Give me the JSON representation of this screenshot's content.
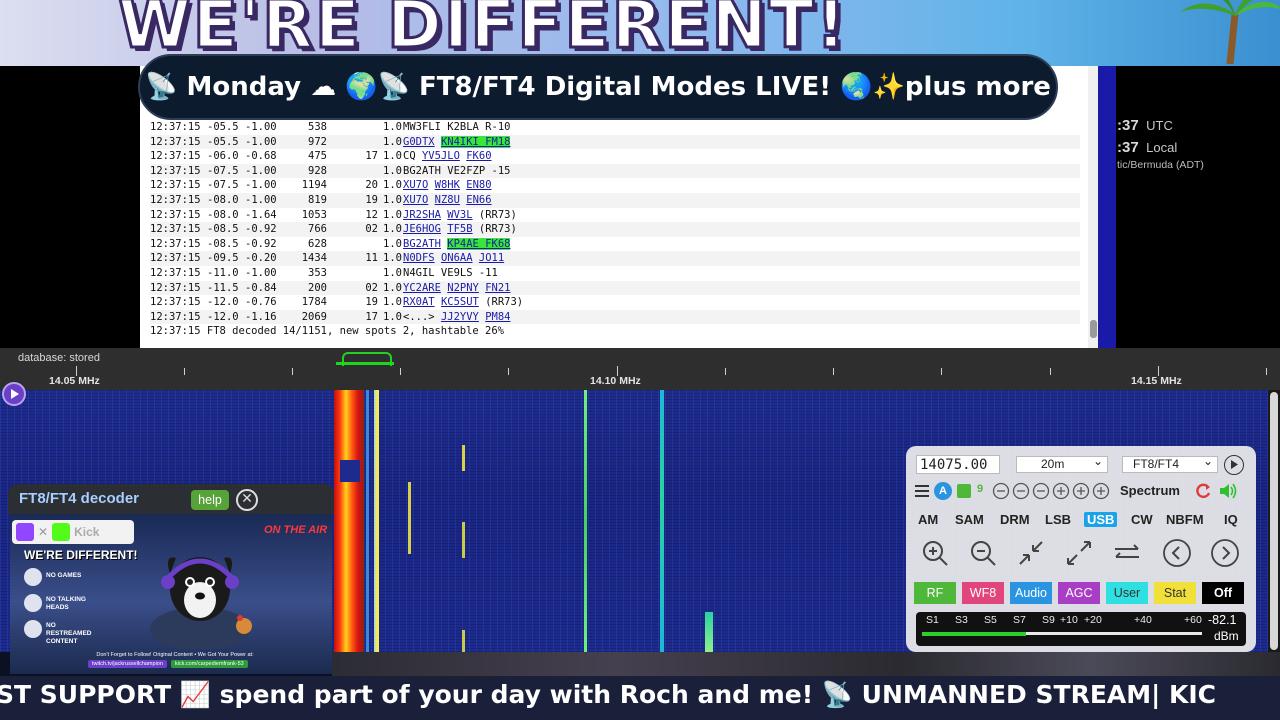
{
  "banner": {
    "text": "WE'RE DIFFERENT!"
  },
  "title_pill": {
    "text": "📡 Monday ☁ 🌍📡 FT8/FT4 Digital Modes LIVE! 🌏✨plus more"
  },
  "clock": {
    "utc_time": ":37",
    "utc_label": "UTC",
    "local_time": ":37",
    "local_label": "Local",
    "timezone": "tic/Bermuda (ADT)"
  },
  "log": {
    "rows": [
      {
        "time": "12:37:15",
        "snr": "-05.5",
        "dt": "-1.00",
        "freq": "538",
        "dist": "",
        "mode": "1.0",
        "msg": [
          {
            "t": "MW3FLI K2BLA R-10",
            "c": ""
          }
        ]
      },
      {
        "time": "12:37:15",
        "snr": "-05.5",
        "dt": "-1.00",
        "freq": "972",
        "dist": "",
        "mode": "1.0",
        "msg": [
          {
            "t": "G0DTX",
            "c": "lnk"
          },
          {
            "t": " ",
            "c": ""
          },
          {
            "t": "KN4IKI FM18",
            "c": "lnk hl"
          }
        ]
      },
      {
        "time": "12:37:15",
        "snr": "-06.0",
        "dt": "-0.68",
        "freq": "475",
        "dist": "17",
        "mode": "1.0",
        "msg": [
          {
            "t": "CQ ",
            "c": ""
          },
          {
            "t": "YV5JLO",
            "c": "lnk"
          },
          {
            "t": " ",
            "c": ""
          },
          {
            "t": "FK60",
            "c": "lnk"
          }
        ]
      },
      {
        "time": "12:37:15",
        "snr": "-07.5",
        "dt": "-1.00",
        "freq": "928",
        "dist": "",
        "mode": "1.0",
        "msg": [
          {
            "t": "BG2ATH VE2FZP -15",
            "c": ""
          }
        ]
      },
      {
        "time": "12:37:15",
        "snr": "-07.5",
        "dt": "-1.00",
        "freq": "1194",
        "dist": "20",
        "mode": "1.0",
        "msg": [
          {
            "t": "XU7O",
            "c": "lnk"
          },
          {
            "t": " ",
            "c": ""
          },
          {
            "t": "W8HK",
            "c": "lnk"
          },
          {
            "t": " ",
            "c": ""
          },
          {
            "t": "EN80",
            "c": "lnk"
          }
        ]
      },
      {
        "time": "12:37:15",
        "snr": "-08.0",
        "dt": "-1.00",
        "freq": "819",
        "dist": "19",
        "mode": "1.0",
        "msg": [
          {
            "t": "XU7O",
            "c": "lnk"
          },
          {
            "t": " ",
            "c": ""
          },
          {
            "t": "NZ8U",
            "c": "lnk"
          },
          {
            "t": " ",
            "c": ""
          },
          {
            "t": "EN66",
            "c": "lnk"
          }
        ]
      },
      {
        "time": "12:37:15",
        "snr": "-08.0",
        "dt": "-1.64",
        "freq": "1053",
        "dist": "12",
        "mode": "1.0",
        "msg": [
          {
            "t": "JR2SHA",
            "c": "lnk"
          },
          {
            "t": " ",
            "c": ""
          },
          {
            "t": "WV3L",
            "c": "lnk"
          },
          {
            "t": " (RR73)",
            "c": ""
          }
        ]
      },
      {
        "time": "12:37:15",
        "snr": "-08.5",
        "dt": "-0.92",
        "freq": "766",
        "dist": "02",
        "mode": "1.0",
        "msg": [
          {
            "t": "JE6HOG",
            "c": "lnk"
          },
          {
            "t": " ",
            "c": ""
          },
          {
            "t": "TF5B",
            "c": "lnk"
          },
          {
            "t": " (RR73)",
            "c": ""
          }
        ]
      },
      {
        "time": "12:37:15",
        "snr": "-08.5",
        "dt": "-0.92",
        "freq": "628",
        "dist": "",
        "mode": "1.0",
        "msg": [
          {
            "t": "BG2ATH",
            "c": "lnk"
          },
          {
            "t": " ",
            "c": ""
          },
          {
            "t": "KP4AE FK68",
            "c": "lnk hl"
          }
        ]
      },
      {
        "time": "12:37:15",
        "snr": "-09.5",
        "dt": "-0.20",
        "freq": "1434",
        "dist": "11",
        "mode": "1.0",
        "msg": [
          {
            "t": "N0DFS",
            "c": "lnk"
          },
          {
            "t": " ",
            "c": ""
          },
          {
            "t": "ON6AA",
            "c": "lnk"
          },
          {
            "t": " ",
            "c": ""
          },
          {
            "t": "JO11",
            "c": "lnk"
          }
        ]
      },
      {
        "time": "12:37:15",
        "snr": "-11.0",
        "dt": "-1.00",
        "freq": "353",
        "dist": "",
        "mode": "1.0",
        "msg": [
          {
            "t": "N4GIL VE9LS -11",
            "c": ""
          }
        ]
      },
      {
        "time": "12:37:15",
        "snr": "-11.5",
        "dt": "-0.84",
        "freq": "200",
        "dist": "02",
        "mode": "1.0",
        "msg": [
          {
            "t": "YC2ARE",
            "c": "lnk"
          },
          {
            "t": " ",
            "c": ""
          },
          {
            "t": "N2PNY",
            "c": "lnk"
          },
          {
            "t": " ",
            "c": ""
          },
          {
            "t": "FN21",
            "c": "lnk"
          }
        ]
      },
      {
        "time": "12:37:15",
        "snr": "-12.0",
        "dt": "-0.76",
        "freq": "1784",
        "dist": "19",
        "mode": "1.0",
        "msg": [
          {
            "t": "RX0AT",
            "c": "lnk"
          },
          {
            "t": " ",
            "c": ""
          },
          {
            "t": "KC5SUT",
            "c": "lnk"
          },
          {
            "t": " (RR73)",
            "c": ""
          }
        ]
      },
      {
        "time": "12:37:15",
        "snr": "-12.0",
        "dt": "-1.16",
        "freq": "2069",
        "dist": "17",
        "mode": "1.0",
        "msg": [
          {
            "t": "<...> ",
            "c": ""
          },
          {
            "t": "JJ2YVY",
            "c": "lnk"
          },
          {
            "t": " ",
            "c": ""
          },
          {
            "t": "PM84",
            "c": "lnk"
          }
        ]
      }
    ],
    "status": "12:37:15 FT8 decoded 14/1151, new spots 2, hashtable 26%"
  },
  "scale": {
    "db_status": "database: stored",
    "labels": [
      "14.05 MHz",
      "14.10 MHz",
      "14.15 MHz"
    ]
  },
  "ft8_panel": {
    "title": "FT8/FT4 decoder",
    "help_label": "help"
  },
  "promo": {
    "heading": "WE'RE DIFFERENT!",
    "on_air": "ON THE AIR",
    "kick_label": "Kick",
    "items": [
      "NO GAMES",
      "NO TALKING HEADS",
      "NO RESTREAMED CONTENT"
    ],
    "footer": "Don't Forget to Follow! Original Content • We Got Your Power at:",
    "link1": "twitch.tv/jackrussellchampion",
    "link2": "kick.com/carpediemfrank-53"
  },
  "controls": {
    "frequency": "14075.00",
    "band": "20m",
    "mode_select": "FT8/FT4",
    "row2_nine": "9",
    "spectrum_label": "Spectrum",
    "modes": [
      "AM",
      "SAM",
      "DRM",
      "LSB",
      "USB",
      "CW",
      "NBFM",
      "IQ"
    ],
    "active_mode": "USB",
    "color_buttons": [
      {
        "label": "RF",
        "color": "#4fb83a"
      },
      {
        "label": "WF8",
        "color": "#e0457b"
      },
      {
        "label": "Audio",
        "color": "#2a94e0"
      },
      {
        "label": "AGC",
        "color": "#a83ec4"
      },
      {
        "label": "User",
        "color": "#2ee0e0"
      },
      {
        "label": "Stat",
        "color": "#f2e03a"
      },
      {
        "label": "Off",
        "color": "#000000"
      }
    ],
    "smeter": {
      "labels": [
        "S1",
        "S3",
        "S5",
        "S7",
        "S9",
        "+10",
        "+20",
        "+40",
        "+60"
      ],
      "value": "-82.1",
      "unit": "dBm",
      "level": 0.37
    }
  },
  "ticker": {
    "text": "ST SUPPORT 📈 spend part of your day with Roch and me!            📡 UNMANNED STREAM| KIC"
  },
  "colors": {
    "waterfall_bg": "#1d2a8e",
    "highlight": "#39e639",
    "link": "#1a1aa8",
    "active_mode": "#1aa3e8"
  }
}
